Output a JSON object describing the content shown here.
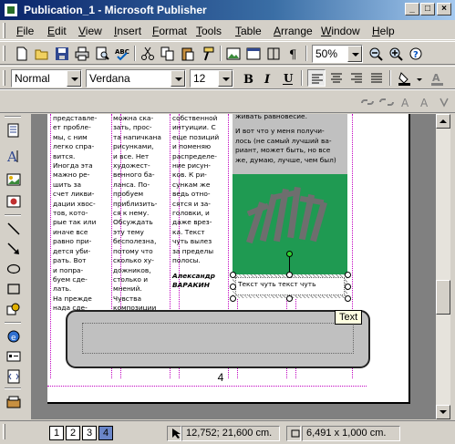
{
  "window": {
    "title": "Publication_1 - Microsoft Publisher",
    "minimize": "_",
    "maximize": "□",
    "close": "×"
  },
  "menu": [
    {
      "label": "File",
      "hotkey": "F",
      "rest": "ile"
    },
    {
      "label": "Edit",
      "hotkey": "E",
      "rest": "dit"
    },
    {
      "label": "View",
      "hotkey": "V",
      "rest": "iew"
    },
    {
      "label": "Insert",
      "hotkey": "I",
      "rest": "nsert"
    },
    {
      "label": "Format",
      "hotkey": "F",
      "rest": "ormat"
    },
    {
      "label": "Tools",
      "hotkey": "T",
      "rest": "ools"
    },
    {
      "label": "Table",
      "hotkey": "T",
      "rest": "able"
    },
    {
      "label": "Arrange",
      "hotkey": "A",
      "rest": "rrange"
    },
    {
      "label": "Window",
      "hotkey": "W",
      "rest": "indow"
    },
    {
      "label": "Help",
      "hotkey": "H",
      "rest": "elp"
    }
  ],
  "standard_toolbar": {
    "zoom": "50%",
    "buttons": [
      "new-icon",
      "open-icon",
      "save-icon",
      "print-icon",
      "print-preview-icon",
      "spelling-icon",
      "cut-icon",
      "copy-icon",
      "paste-icon",
      "format-painter-icon",
      "insert-picture-icon",
      "zoom-out-icon",
      "zoom-in-icon"
    ]
  },
  "formatting_toolbar": {
    "style": "Normal",
    "font": "Verdana",
    "size": "12"
  },
  "document": {
    "col1": [
      "представле-",
      "ет пробле-",
      "мы, с ним",
      "легко спра-",
      "вится.",
      "Иногда эта",
      "мажно ре-",
      "шить за",
      "счет ликви-",
      "дации хвос-",
      "тов, кото-",
      "рые так или",
      "иначе все",
      "равно при-",
      "дется уби-",
      "рать. Вот",
      "и попра-",
      "буем сде-",
      "лать.",
      "На прежде",
      "нада сде-"
    ],
    "col2": [
      "можна ска-",
      "зать, прос-",
      "та напичкана",
      "рисунками,",
      "и все. Нет",
      "художест-",
      "венного ба-",
      "ланса. По-",
      "пробуем",
      "приблизить-",
      "ся к нему.",
      "Обсуждать",
      "эту тему",
      "бесполезна,",
      "потому что",
      "сколько ху-",
      "дожников,",
      "столько и",
      "мнений.",
      "Чувства",
      "композиции"
    ],
    "col3": [
      "собственной",
      "интуиции. С",
      "еще позиций",
      "и поменяю",
      "распределе-",
      "ние рисун-",
      "ков. К ри-",
      "сункам же",
      "ведь отно-",
      "сятся и за-",
      "головки, и",
      "даже врез-",
      "ка. Текст",
      "чуть вылез",
      "за пределы",
      "полосы."
    ],
    "signature": [
      "Александр",
      "ВАРАКИН"
    ],
    "col4_top": "живать равновесие.",
    "col4": [
      "И вот что у меня получи-",
      "лось (не самый лучший ва-",
      "риант, может быть, но все",
      "же, думаю, лучше, чем был)"
    ],
    "caption": "Текст чуть текст чуть",
    "tooltip": "Text",
    "page_number": "4"
  },
  "status": {
    "pages": [
      "1",
      "2",
      "3",
      "4"
    ],
    "active_page": "4",
    "position": "12,752; 21,600 cm.",
    "size": "6,491 x  1,000 cm."
  }
}
